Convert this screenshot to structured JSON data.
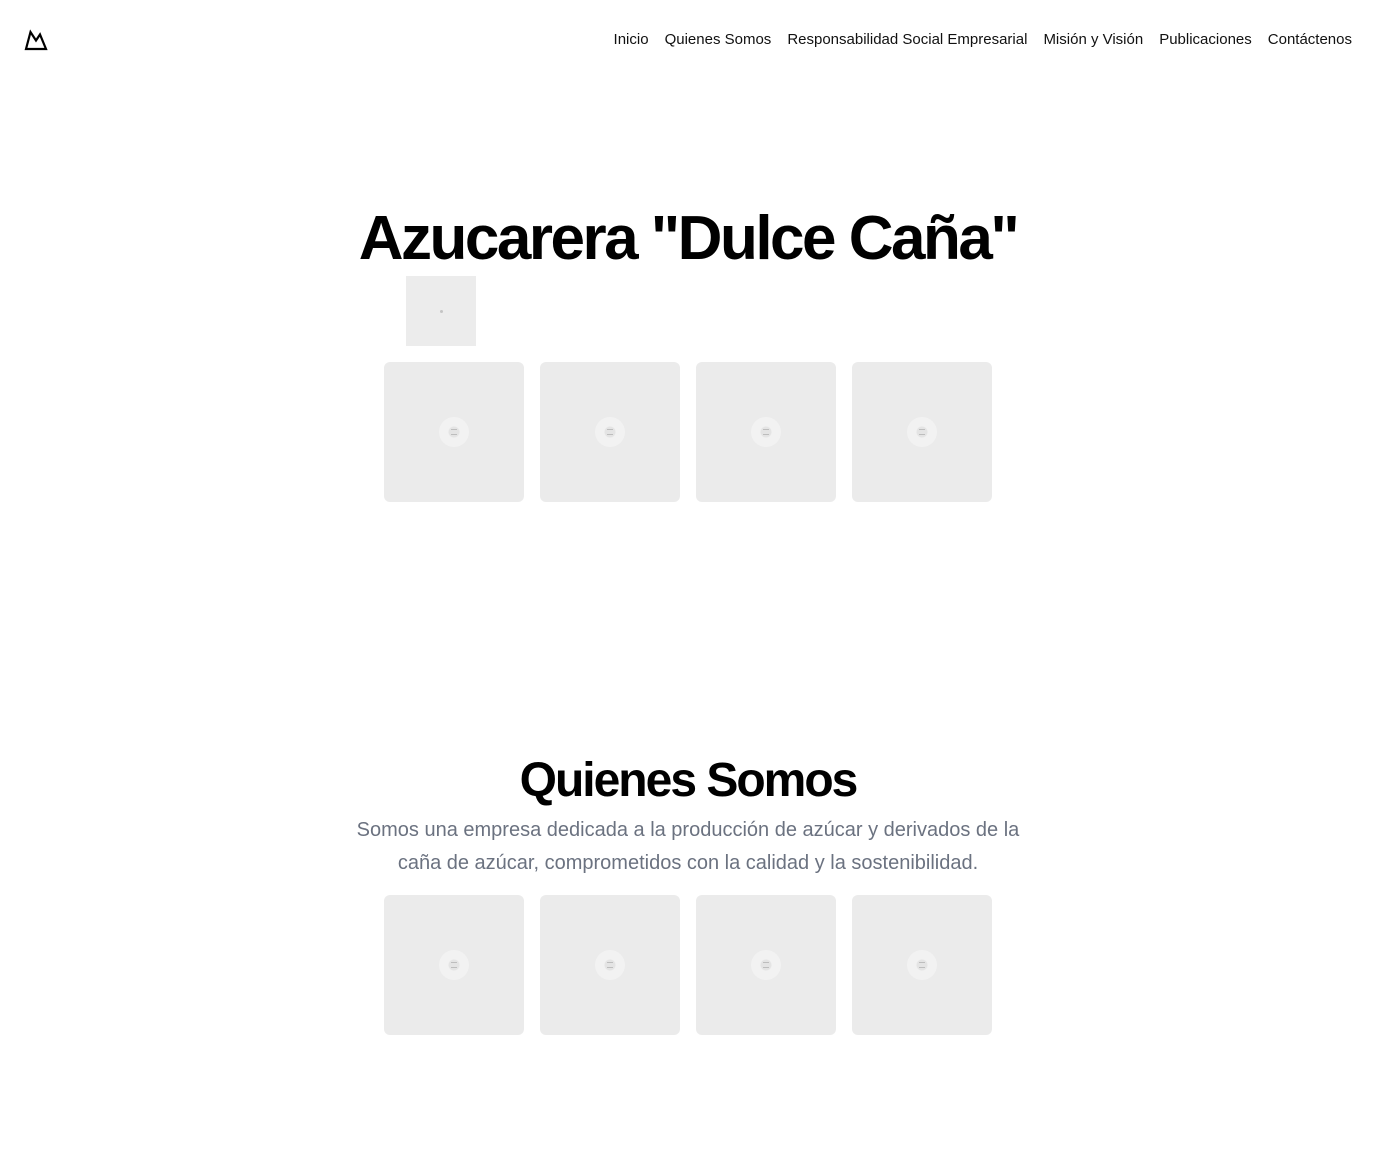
{
  "header": {
    "logo_icon": "mountain-logo-icon",
    "nav": [
      {
        "label": "Inicio"
      },
      {
        "label": "Quienes Somos"
      },
      {
        "label": "Responsabilidad Social Empresarial"
      },
      {
        "label": "Misión y Visión"
      },
      {
        "label": "Publicaciones"
      },
      {
        "label": "Contáctenos"
      }
    ]
  },
  "hero": {
    "title": "Azucarera \"Dulce Caña\"",
    "gallery_count": 4
  },
  "about": {
    "title": "Quienes Somos",
    "text": "Somos una empresa dedicada a la producción de azúcar y derivados de la caña de azúcar, comprometidos con la calidad y la sostenibilidad.",
    "gallery_count": 4
  },
  "colors": {
    "text": "#000000",
    "muted": "#6b7280",
    "placeholder": "#ebebeb"
  }
}
